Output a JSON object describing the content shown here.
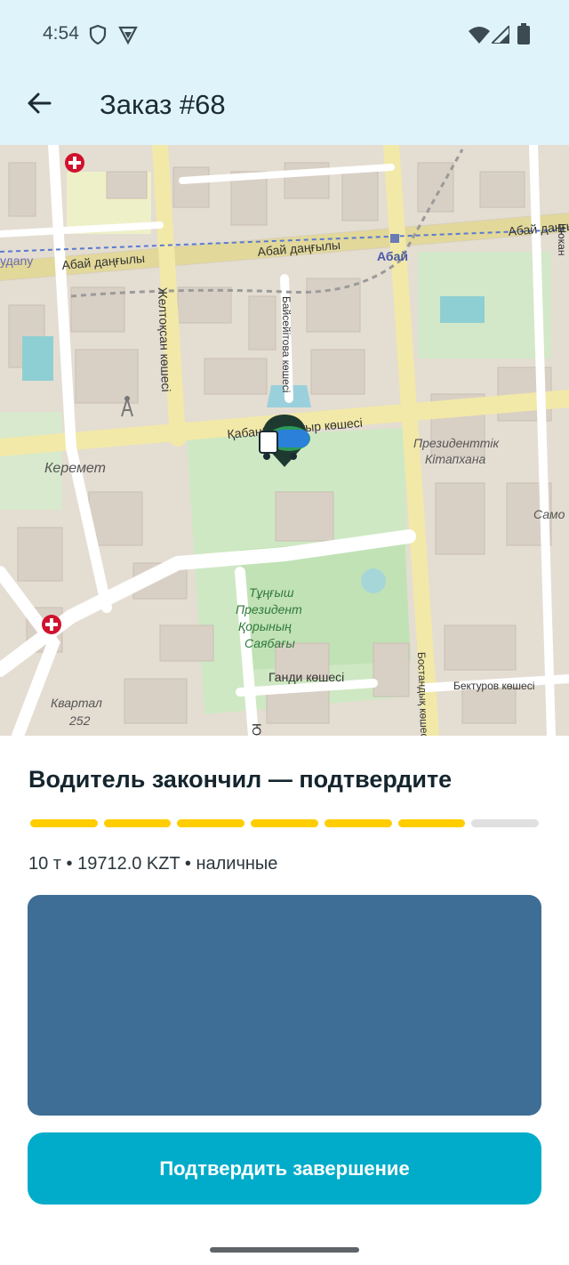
{
  "status_bar": {
    "time": "4:54",
    "icons": [
      "shield-icon",
      "vpn-icon",
      "wifi-icon",
      "signal-icon",
      "battery-icon"
    ]
  },
  "app_bar": {
    "title": "Заказ #68",
    "back_icon": "arrow-left-icon"
  },
  "map": {
    "labels": {
      "abay_left": "Абай даңғылы",
      "abay_mid": "Абай даңғылы",
      "abay_right": "Абай даңғылы",
      "abay_metro": "Абай",
      "udany": "удany",
      "zheltoksan": "Желтоқсан көшесі",
      "baiseitova": "Байсейітова көшесі",
      "kabanbay": "Қабанбай батыр көшесі",
      "prez_lib_1": "Президенттік",
      "prez_lib_2": "Кітапхана",
      "keremet": "Керемет",
      "park_1": "Тұңғыш",
      "park_2": "Президент",
      "park_3": "Қорының",
      "park_4": "Саябағы",
      "gandi": "Ганди көшесі",
      "bekturov": "Бектуров көшесі",
      "kvartal_1": "Квартал",
      "kvartal_2": "252",
      "bostandyk": "Бостандық көшесі",
      "shokan": "Шокан",
      "samo": "Само",
      "yuri": "Юрий Г"
    },
    "marker_icon": "truck-marker-icon"
  },
  "order": {
    "status_heading": "Водитель закончил — подтвердите",
    "progress": {
      "completed": 6,
      "total": 7
    },
    "details": "10 т • 19712.0 KZT • наличные",
    "confirm_label": "Подтвердить завершение"
  },
  "colors": {
    "appbar_bg": "#dff3fa",
    "progress_done": "#ffcd00",
    "progress_todo": "#e0e0e0",
    "media_bg": "#3e6e95",
    "accent": "#00acc9"
  }
}
